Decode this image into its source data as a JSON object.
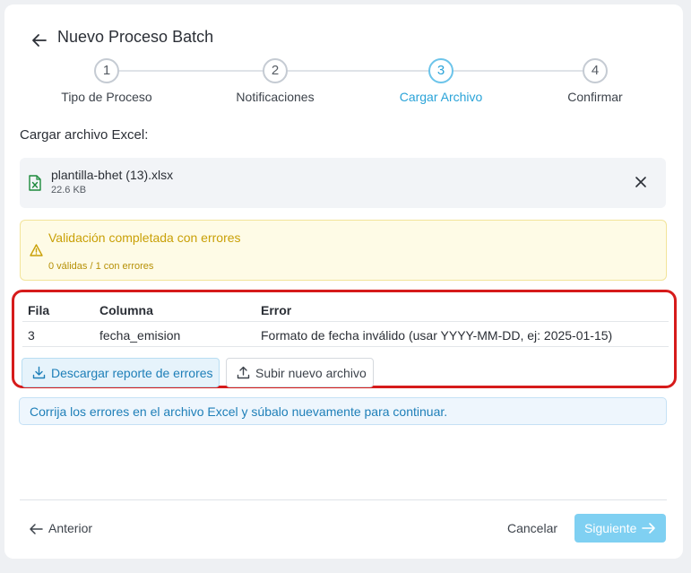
{
  "header": {
    "title": "Nuevo Proceso Batch"
  },
  "stepper": {
    "steps": [
      {
        "number": "1",
        "label": "Tipo de Proceso"
      },
      {
        "number": "2",
        "label": "Notificaciones"
      },
      {
        "number": "3",
        "label": "Cargar Archivo"
      },
      {
        "number": "4",
        "label": "Confirmar"
      }
    ],
    "active_step": 3
  },
  "upload": {
    "label": "Cargar archivo Excel:",
    "file_name": "plantilla-bhet (13).xlsx",
    "file_size": "22.6 KB"
  },
  "warning": {
    "title": "Validación completada con errores",
    "summary": "0 válidas / 1 con errores"
  },
  "errors": {
    "columns": [
      "Fila",
      "Columna",
      "Error"
    ],
    "rows": [
      [
        "3",
        "fecha_emision",
        "Formato de fecha inválido (usar YYYY-MM-DD, ej: 2025-01-15)"
      ]
    ],
    "download_label": "Descargar reporte de errores",
    "upload_new_label": "Subir nuevo archivo"
  },
  "info": {
    "message": "Corrija los errores en el archivo Excel y súbalo nuevamente para continuar."
  },
  "footer": {
    "previous_label": "Anterior",
    "cancel_label": "Cancelar",
    "next_label": "Siguiente"
  },
  "colors": {
    "accent": "#2aa3d8",
    "warning": "#c9a007",
    "error_outline": "#d61b1b",
    "next_button": "#7fd0f2"
  },
  "icons": [
    "arrow-left-icon",
    "excel-file-icon",
    "close-icon",
    "warning-icon",
    "download-icon",
    "upload-icon",
    "arrow-right-icon"
  ]
}
